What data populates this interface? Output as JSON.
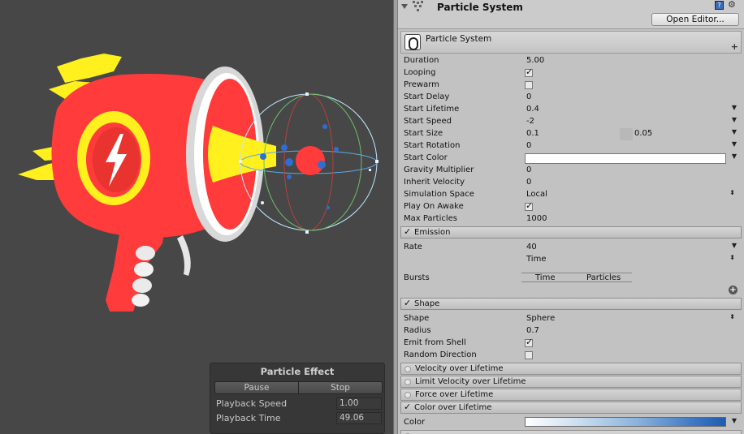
{
  "inspector": {
    "component_title": "Particle System",
    "open_editor_label": "Open Editor...",
    "module_title": "Particle System",
    "properties": [
      {
        "label": "Duration",
        "value": "5.00"
      },
      {
        "label": "Looping",
        "value": "",
        "checked": true
      },
      {
        "label": "Prewarm",
        "value": "",
        "checked": false
      },
      {
        "label": "Start Delay",
        "value": "0"
      },
      {
        "label": "Start Lifetime",
        "value": "0.4"
      },
      {
        "label": "Start Speed",
        "value": "-2"
      },
      {
        "label": "Start Size",
        "value": "0.1",
        "value2": "0.05"
      },
      {
        "label": "Start Rotation",
        "value": "0"
      },
      {
        "label": "Start Color",
        "value": ""
      },
      {
        "label": "Gravity Multiplier",
        "value": "0"
      },
      {
        "label": "Inherit Velocity",
        "value": "0"
      },
      {
        "label": "Simulation Space",
        "value": "Local"
      },
      {
        "label": "Play On Awake",
        "value": "",
        "checked": true
      },
      {
        "label": "Max Particles",
        "value": "1000"
      }
    ],
    "emission": {
      "title": "Emission",
      "rate_label": "Rate",
      "rate_value": "40",
      "rate_mode": "Time",
      "bursts_label": "Bursts",
      "bursts_col_time": "Time",
      "bursts_col_particles": "Particles"
    },
    "shape": {
      "title": "Shape",
      "shape_label": "Shape",
      "shape_value": "Sphere",
      "radius_label": "Radius",
      "radius_value": "0.7",
      "emit_shell_label": "Emit from Shell",
      "random_dir_label": "Random Direction"
    },
    "modules": [
      {
        "label": "Velocity over Lifetime",
        "enabled": false
      },
      {
        "label": "Limit Velocity over Lifetime",
        "enabled": false
      },
      {
        "label": "Force over Lifetime",
        "enabled": false
      },
      {
        "label": "Color over Lifetime",
        "enabled": true
      }
    ],
    "color_label": "Color"
  },
  "particle_effect": {
    "title": "Particle Effect",
    "pause_label": "Pause",
    "stop_label": "Stop",
    "playback_speed_label": "Playback Speed",
    "playback_speed_value": "1.00",
    "playback_time_label": "Playback Time",
    "playback_time_value": "49.06"
  },
  "colors": {
    "scene_bg": "#474747",
    "inspector_bg": "#c2c2c2",
    "gun_red": "#ff3b3b",
    "gun_yellow": "#fff01e",
    "gradient_end": "#1f5bb0"
  }
}
